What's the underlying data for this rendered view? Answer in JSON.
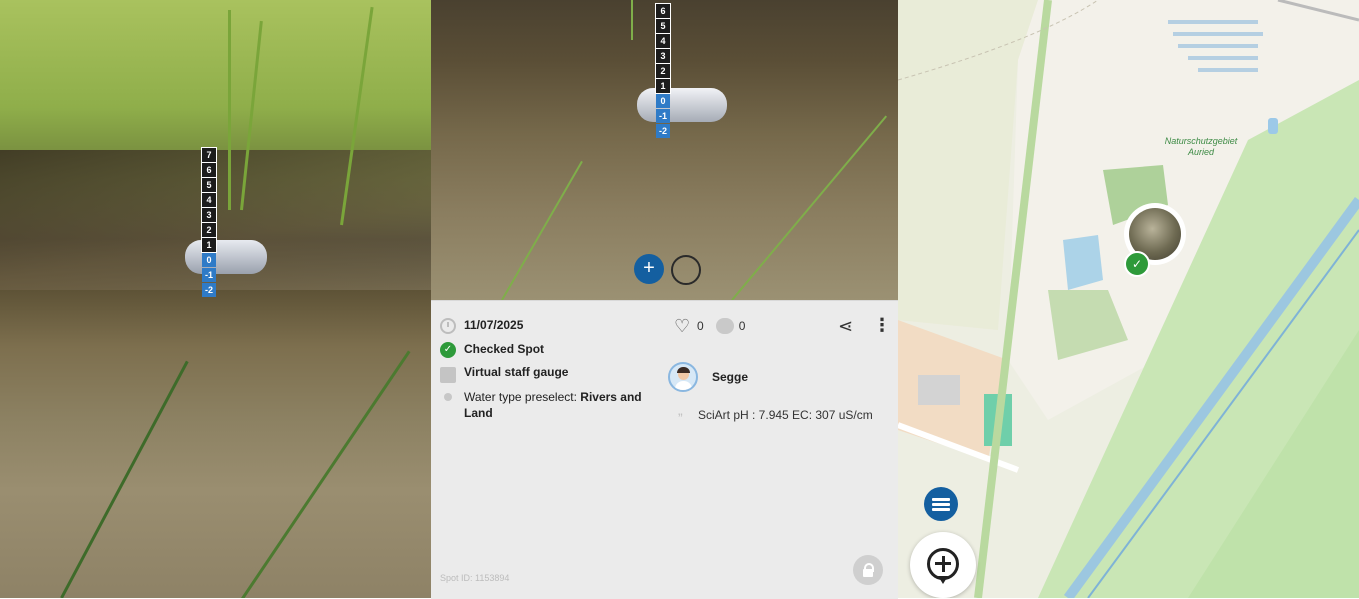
{
  "gauge": {
    "left_photo_ticks": [
      "7",
      "6",
      "5",
      "4",
      "3",
      "2",
      "1",
      "0",
      "-1",
      "-2"
    ],
    "mid_photo_ticks": [
      "6",
      "5",
      "4",
      "3",
      "2",
      "1",
      "0",
      "-1",
      "-2"
    ]
  },
  "spot": {
    "date": "11/07/2025",
    "status": "Checked Spot",
    "category": "Virtual staff gauge",
    "water_type_prefix": "Water type preselect: ",
    "water_type_value": "Rivers and Land",
    "likes": "0",
    "comments": "0",
    "author": "Segge",
    "comment_text": "SciArt pH : 7.945 EC: 307 uS/cm",
    "spot_id": "Spot ID: 1153894"
  },
  "map": {
    "area_label_line1": "Naturschutzgebiet",
    "area_label_line2": "Auried"
  },
  "colors": {
    "accent_blue": "#145fa0",
    "check_green": "#2e9a3a"
  },
  "icons": {
    "clock": "clock-icon",
    "check": "check-circle-icon",
    "folder": "folder-icon",
    "heart": "heart-icon",
    "comment": "comment-icon",
    "share": "share-icon",
    "more": "more-vert-icon",
    "lock": "lock-icon",
    "add": "plus-icon",
    "layers": "layers-icon",
    "zoom": "add-location-icon"
  }
}
